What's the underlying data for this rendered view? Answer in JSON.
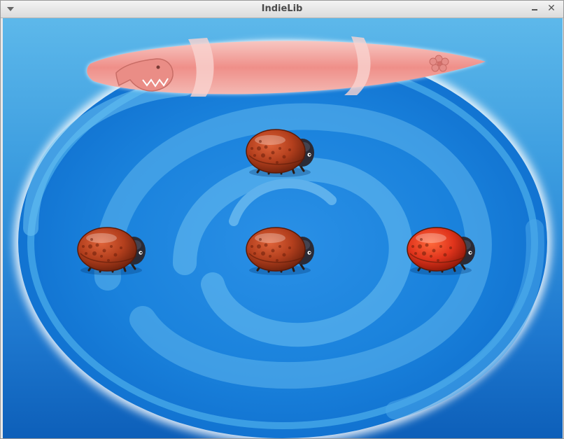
{
  "window": {
    "title": "IndieLib",
    "menu_icon": "chevron-down-icon",
    "minimize_icon": "minimize-icon",
    "close_icon": "close-icon",
    "close_glyph": "✕"
  },
  "scene": {
    "background_color": "#3c9de0",
    "pool_color": "#1b8ee0",
    "surfboard": {
      "colors": [
        "#f0b2ad",
        "#ef8c86"
      ],
      "decorations": [
        "shark-icon",
        "flower-icon"
      ]
    },
    "beetles": [
      {
        "name": "beetle-top",
        "color": "#b8421e",
        "highlighted": false
      },
      {
        "name": "beetle-left",
        "color": "#b8421e",
        "highlighted": false
      },
      {
        "name": "beetle-center",
        "color": "#b8421e",
        "highlighted": false
      },
      {
        "name": "beetle-right",
        "color": "#e0341c",
        "highlighted": true
      }
    ]
  }
}
